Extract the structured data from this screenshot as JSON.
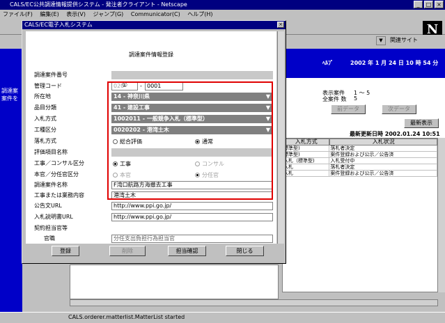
{
  "browser": {
    "title": "CALS/EC公共調達情報提供システム - 発注者クライアント - Netscape",
    "menu": [
      "ファイル(F)",
      "編集(E)",
      "表示(V)",
      "ジャンプ(G)",
      "Communicator(C)",
      "ヘルプ(H)"
    ],
    "related_sites": "関連サイト",
    "status_text": "CALS.orderer.matterlist.MatterList started"
  },
  "background": {
    "left_text": [
      "調達案",
      "案件を"
    ],
    "help": "ﾍﾙﾌﾟ",
    "date": "2002 年  1 月 24 日   10 時 54 分",
    "display_label": "表示案件",
    "display_value": "1 ～ 5",
    "total_label": "全案件 数",
    "total_value": "5",
    "prev_button": "前データ",
    "next_button": "次データ",
    "refresh_button": "最新表示",
    "last_updated": "最新更新日時 2002.01.24 10:51",
    "table_headers": [
      "入札方式",
      "入札状況"
    ],
    "table_rows": [
      [
        "標準型)",
        "落札者決定"
      ],
      [
        "標準型)",
        "案件登録および公示／公告済"
      ],
      [
        "入札（標準型)",
        "入札受付中"
      ],
      [
        "入札",
        "落札者決定"
      ],
      [
        "入札",
        "案件登録および公示／公告済"
      ]
    ]
  },
  "dialog": {
    "title": "CALS/EC電子入札システム",
    "close": "×",
    "form_title": "調達案件情報登録",
    "circle_marker": "①",
    "labels": {
      "case_number": "調達案件番号",
      "admin_code": "管理コード",
      "location": "所在地",
      "category": "品目分類",
      "bid_method": "入札方式",
      "work_type": "工種区分",
      "award_method": "落札方式",
      "evaluation_item": "評価項目名称",
      "construction_consul": "工事／コンサル区分",
      "office_branch": "本官／分任官区分",
      "case_name": "調達案件名称",
      "work_content": "工事または業務内容",
      "notice_url": "公告文URL",
      "bid_doc_url": "入札説明書URL",
      "contract_officer": "契約担当官等",
      "official_title": "官職"
    },
    "admin_code_prefix": "020",
    "admin_code_sep": "-",
    "admin_code_value": "0001",
    "location_value": "14 - 神奈川県",
    "category_value": "41 - 建設工事",
    "bid_method_value": "1002011 - 一般競争入札（標準型）",
    "work_type_value": "0020202 - 港湾土木",
    "award_options": [
      "総合評価",
      "通常"
    ],
    "construction_options": [
      "工事",
      "コンサル"
    ],
    "office_options": [
      "本官",
      "分任官"
    ],
    "case_name_value": "F湾口航路方海撤去工事",
    "work_content_value": "港湾土木",
    "notice_url_value": "http://www.ppi.go.jp/",
    "bid_doc_url_value": "http://www.ppi.go.jp/",
    "official_value": "分任支出負担行為担当官",
    "buttons": {
      "register": "登録",
      "delete": "削除",
      "confirm_officer": "担当確認",
      "close": "閉じる"
    }
  },
  "colors": {
    "highlight_border": "#e00000",
    "title_bar": "#000080",
    "page_blue": "#0000c8"
  }
}
